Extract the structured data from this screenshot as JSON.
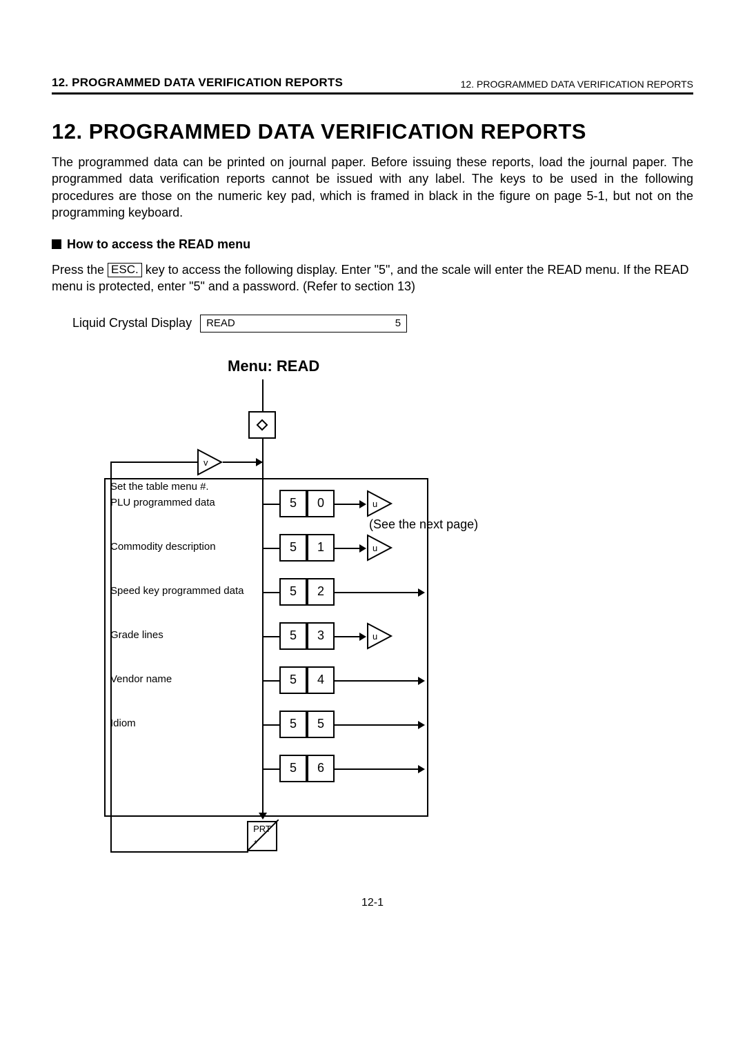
{
  "header": {
    "left": "12. PROGRAMMED DATA VERIFICATION REPORTS",
    "right": "12. PROGRAMMED DATA VERIFICATION REPORTS"
  },
  "title": "12.  PROGRAMMED DATA VERIFICATION REPORTS",
  "paragraph1": "The programmed data can be printed on journal paper.  Before issuing these reports, load the journal paper.  The programmed data verification reports cannot be issued with any label.  The keys to be used in the following procedures are those on the numeric key pad, which is framed in black in the figure on page 5-1, but not on the programming keyboard.",
  "subhead": "How to access the READ menu",
  "para2_a": "Press the ",
  "para2_key": "ESC.",
  "para2_b": " key to access the following display.  Enter \"5\", and the scale will enter the READ menu.  If the READ menu is protected, enter \"5\" and a password.  (Refer to section 13)",
  "lcd": {
    "label": "Liquid Crystal Display",
    "left": "READ",
    "right": "5"
  },
  "menu_title": "Menu:  READ",
  "rows": {
    "header": "Set the table menu #.",
    "r0": {
      "label": "PLU programmed data",
      "d1": "5",
      "d2": "0",
      "tri": "u"
    },
    "r1": {
      "label": "Commodity description",
      "d1": "5",
      "d2": "1",
      "tri": "u"
    },
    "r2": {
      "label": "Speed key programmed data",
      "d1": "5",
      "d2": "2"
    },
    "r3": {
      "label": "Grade lines",
      "d1": "5",
      "d2": "3",
      "tri": "u"
    },
    "r4": {
      "label": "Vendor name",
      "d1": "5",
      "d2": "4"
    },
    "r5": {
      "label": "Idiom",
      "d1": "5",
      "d2": "5"
    },
    "r6": {
      "d1": "5",
      "d2": "6"
    }
  },
  "v_tri": "v",
  "prt": "PRT",
  "prt_star": "*",
  "see_next": "(See the next page)",
  "page_num": "12-1"
}
